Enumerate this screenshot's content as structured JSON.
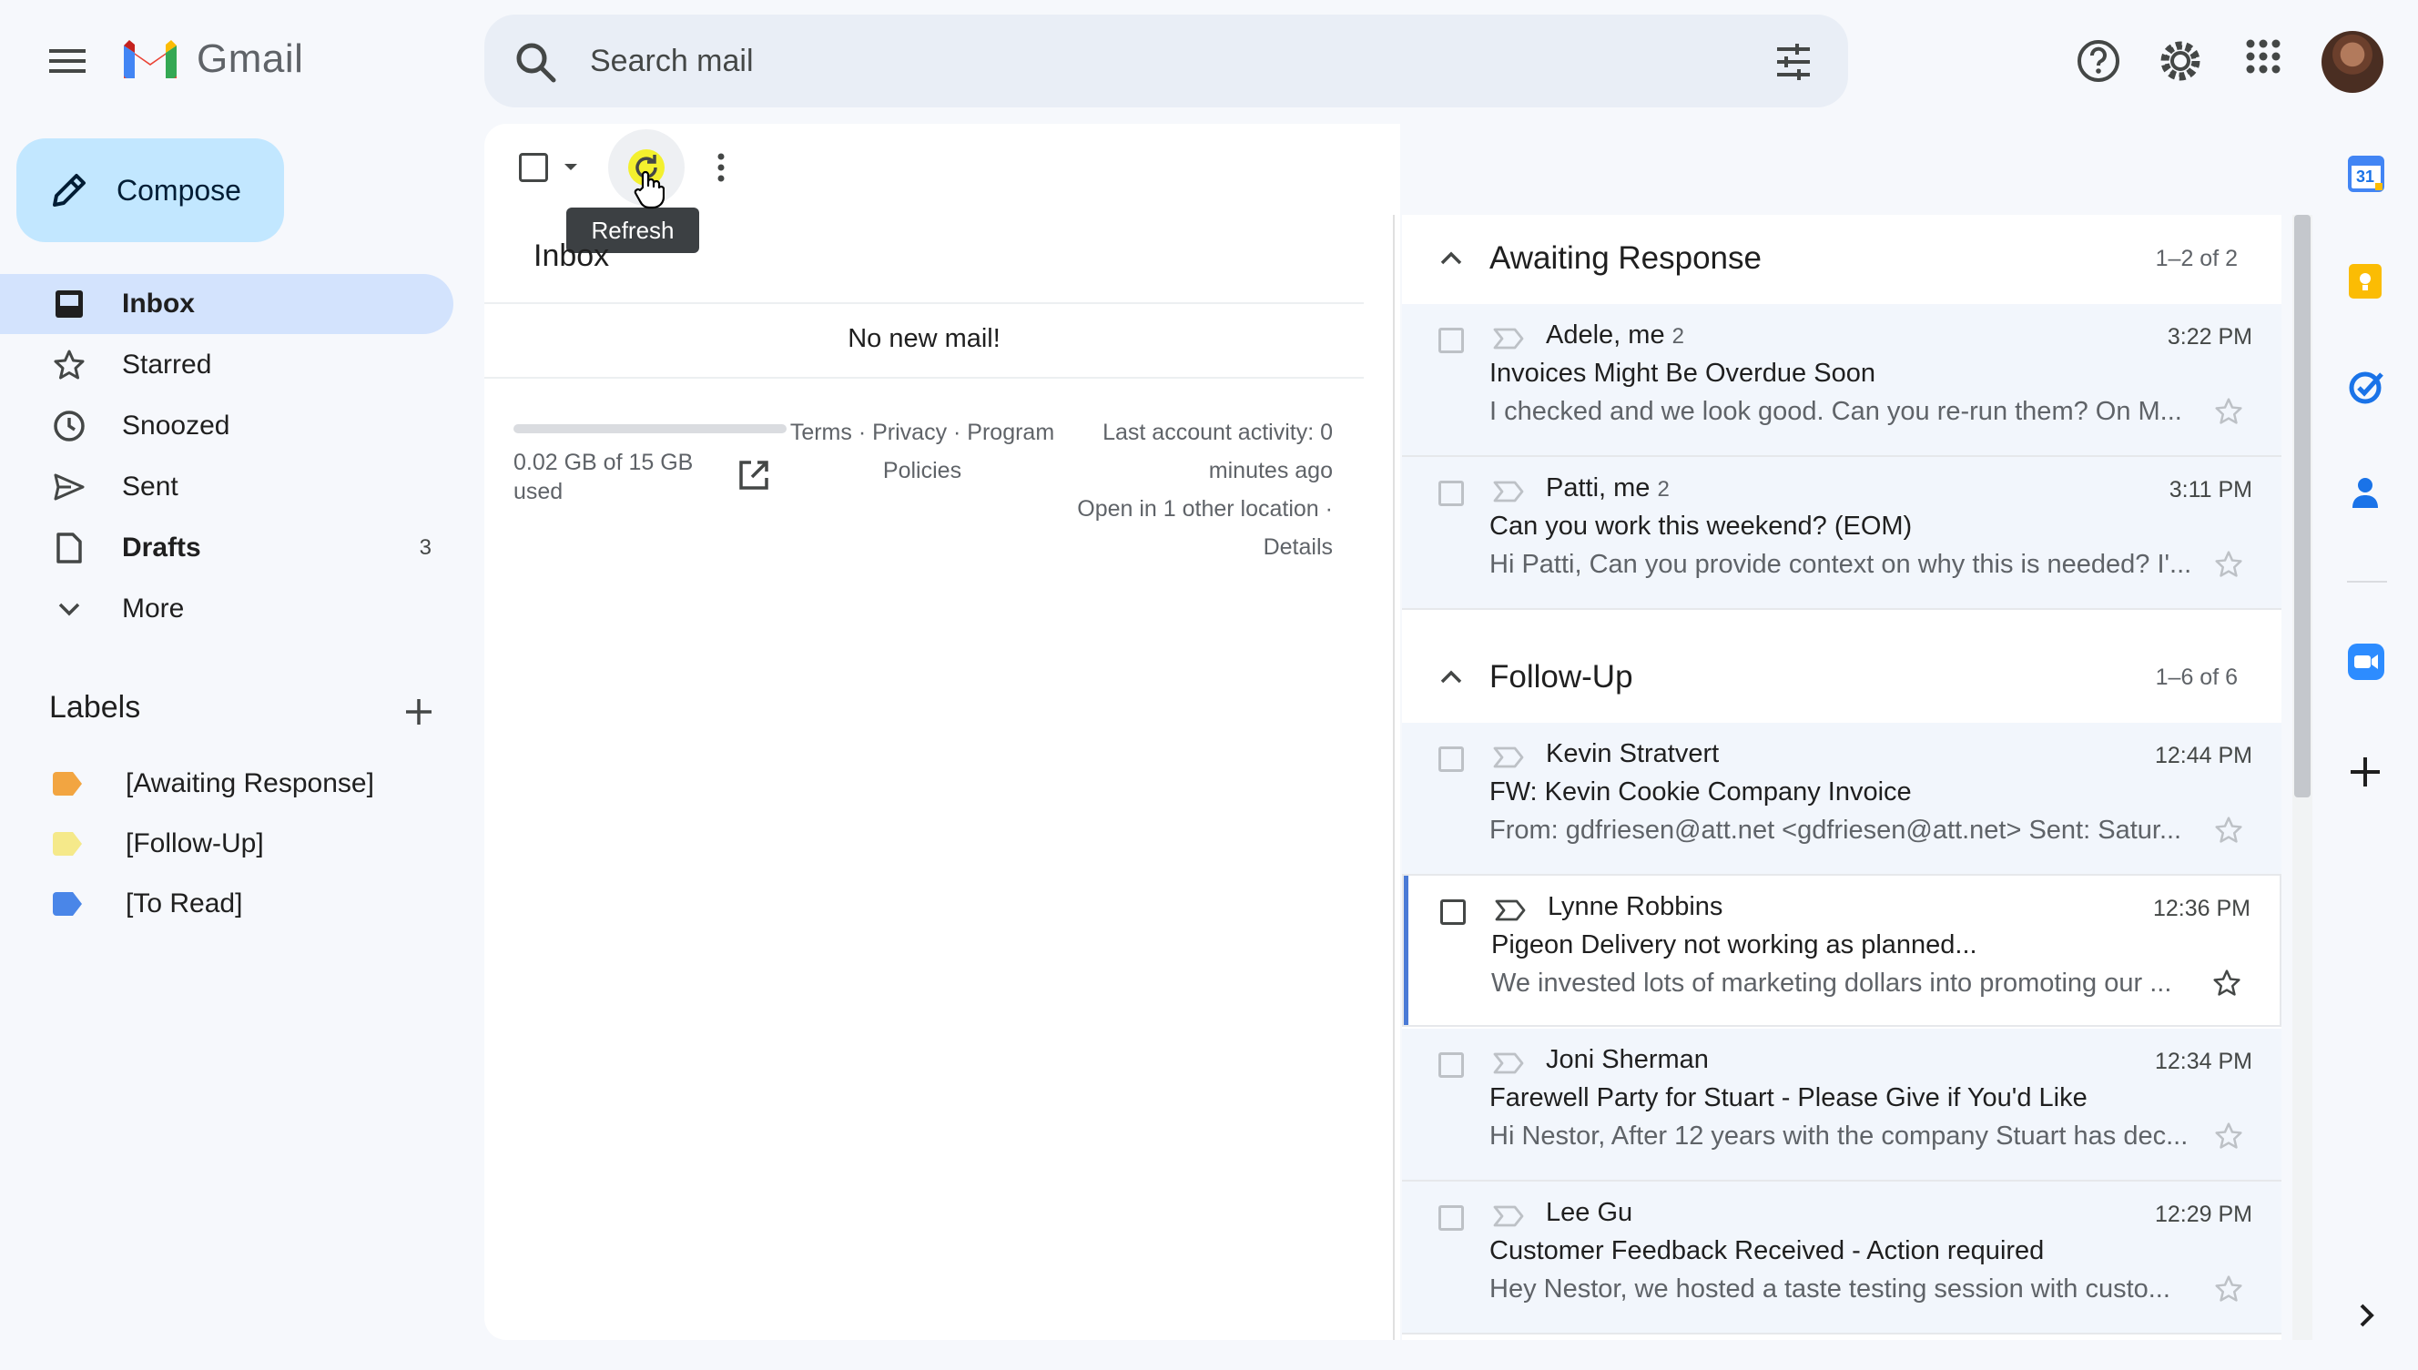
{
  "app": {
    "name": "Gmail"
  },
  "search": {
    "placeholder": "Search mail"
  },
  "compose": {
    "label": "Compose"
  },
  "nav": [
    {
      "label": "Inbox",
      "active": true,
      "icon": "inbox-icon"
    },
    {
      "label": "Starred",
      "icon": "star-icon"
    },
    {
      "label": "Snoozed",
      "icon": "clock-icon"
    },
    {
      "label": "Sent",
      "icon": "send-icon"
    },
    {
      "label": "Drafts",
      "count": "3",
      "icon": "draft-icon"
    },
    {
      "label": "More",
      "icon": "chevron-down-icon"
    }
  ],
  "labels": {
    "title": "Labels",
    "items": [
      {
        "label": "[Awaiting Response]",
        "color": "#f2a541"
      },
      {
        "label": "[Follow-Up]",
        "color": "#f5e98a"
      },
      {
        "label": "[To Read]",
        "color": "#4a86e8"
      }
    ]
  },
  "toolbar": {
    "refresh_tooltip": "Refresh"
  },
  "inbox": {
    "title": "Inbox",
    "empty_message": "No new mail!",
    "storage": {
      "text": "0.02 GB of 15 GB used",
      "used_fraction": 0.0013
    },
    "footer_links": {
      "terms": "Terms",
      "privacy": "Privacy",
      "program_policies": "Program Policies",
      "sep": " · "
    },
    "activity": {
      "line1": "Last account activity: 0 minutes ago",
      "line2": "Open in 1 other location",
      "details": "Details"
    }
  },
  "sections": [
    {
      "title": "Awaiting Response",
      "count": "1–2 of 2",
      "rows": [
        {
          "sender": "Adele, me",
          "thread": "2",
          "time": "3:22 PM",
          "subject": "Invoices Might Be Overdue Soon",
          "snippet": "I checked and we look good. Can you re-run them? On M..."
        },
        {
          "sender": "Patti, me",
          "thread": "2",
          "time": "3:11 PM",
          "subject": "Can you work this weekend? (EOM)",
          "snippet": "Hi Patti, Can you provide context on why this is needed? I'..."
        }
      ]
    },
    {
      "title": "Follow-Up",
      "count": "1–6 of 6",
      "rows": [
        {
          "sender": "Kevin Stratvert",
          "time": "12:44 PM",
          "subject": "FW: Kevin Cookie Company Invoice",
          "snippet": "From: gdfriesen@att.net <gdfriesen@att.net> Sent: Satur..."
        },
        {
          "sender": "Lynne Robbins",
          "time": "12:36 PM",
          "subject": "Pigeon Delivery not working as planned...",
          "snippet": "We invested lots of marketing dollars into promoting our ...",
          "selected": true
        },
        {
          "sender": "Joni Sherman",
          "time": "12:34 PM",
          "subject": "Farewell Party for Stuart - Please Give if You'd Like",
          "snippet": "Hi Nestor, After 12 years with the company Stuart has dec..."
        },
        {
          "sender": "Lee Gu",
          "time": "12:29 PM",
          "subject": "Customer Feedback Received - Action required",
          "snippet": "Hey Nestor, we hosted a taste testing session with custo..."
        }
      ]
    }
  ],
  "side_panel": {
    "calendar_day": "31",
    "icons": [
      "calendar-icon",
      "keep-icon",
      "tasks-icon",
      "contacts-icon",
      "zoom-icon",
      "add-icon",
      "expand-panel-icon"
    ]
  },
  "colors": {
    "accent": "#0b57d0",
    "compose_bg": "#c2e7ff",
    "active_nav": "#d3e3fd",
    "surface": "#f6f8fc"
  }
}
